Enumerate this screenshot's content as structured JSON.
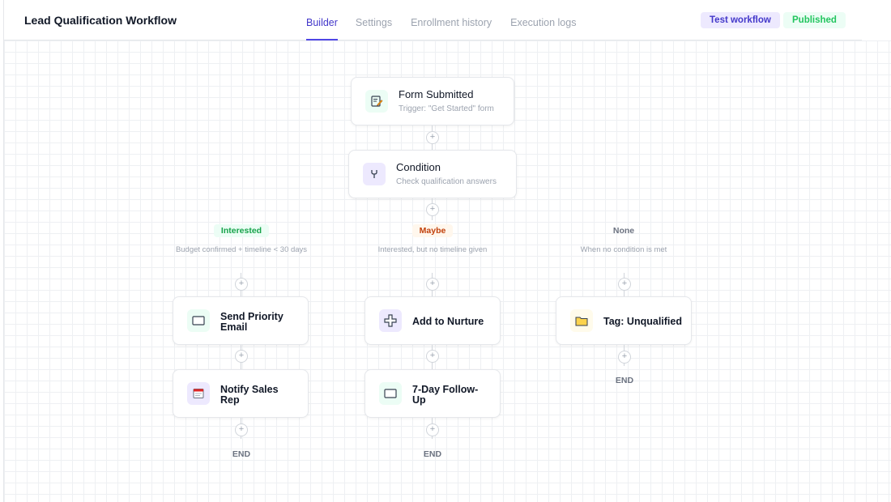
{
  "header": {
    "title": "Lead Qualification Workflow",
    "tabs": [
      {
        "label": "Builder",
        "active": true
      },
      {
        "label": "Settings",
        "active": false
      },
      {
        "label": "Enrollment history",
        "active": false
      },
      {
        "label": "Execution logs",
        "active": false
      }
    ],
    "test_button": "Test workflow",
    "status": "Published"
  },
  "trigger": {
    "title": "Form Submitted",
    "subtitle": "Trigger: \"Get Started\" form",
    "icon": "form-icon"
  },
  "condition": {
    "title": "Condition",
    "subtitle": "Check qualification answers",
    "icon": "branch-icon"
  },
  "branches": [
    {
      "label": "Interested",
      "description": "Budget confirmed + timeline < 30 days",
      "color": "#16a34a",
      "steps": [
        {
          "title": "Send Priority Email",
          "icon": "email-icon"
        },
        {
          "title": "Notify Sales Rep",
          "icon": "calendar-icon"
        }
      ],
      "end": "END"
    },
    {
      "label": "Maybe",
      "description": "Interested, but no timeline given",
      "color": "#c2410c",
      "steps": [
        {
          "title": "Add to Nurture",
          "icon": "plus-cross-icon"
        },
        {
          "title": "7-Day Follow-Up",
          "icon": "email-icon"
        }
      ],
      "end": "END"
    },
    {
      "label": "None",
      "description": "When no condition is met",
      "color": "#6b7280",
      "steps": [
        {
          "title": "Tag: Unqualified",
          "icon": "folder-icon"
        }
      ],
      "end": "END"
    }
  ],
  "colors": {
    "accent": "#4f46e5",
    "published": "#22c55e"
  }
}
